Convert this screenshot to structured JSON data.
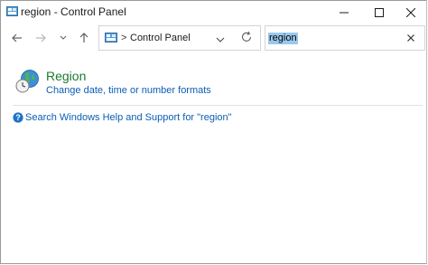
{
  "window": {
    "title": "region - Control Panel",
    "app_icon": "control-panel-icon",
    "controls": [
      "minimize-icon",
      "maximize-icon",
      "close-icon"
    ]
  },
  "navigation": {
    "back_icon": "back-arrow-icon",
    "forward_icon": "forward-arrow-icon",
    "recent_icon": "chevron-down-icon",
    "up_icon": "up-arrow-icon",
    "address": {
      "separator": ">",
      "path": "Control Panel",
      "dropdown_icon": "chevron-down-icon"
    },
    "refresh_icon": "refresh-icon",
    "search": {
      "value": "region",
      "clear_icon": "close-icon"
    }
  },
  "results": {
    "item": {
      "icon": "globe-clock-icon",
      "title": "Region",
      "subtitle": "Change date, time or number formats"
    },
    "help_link": "Search Windows Help and Support for \"region\"",
    "help_icon": "help-icon",
    "colors": {
      "title": "#1a7a2e",
      "link": "#0b5eb4",
      "selection": "#99c9ef"
    }
  }
}
